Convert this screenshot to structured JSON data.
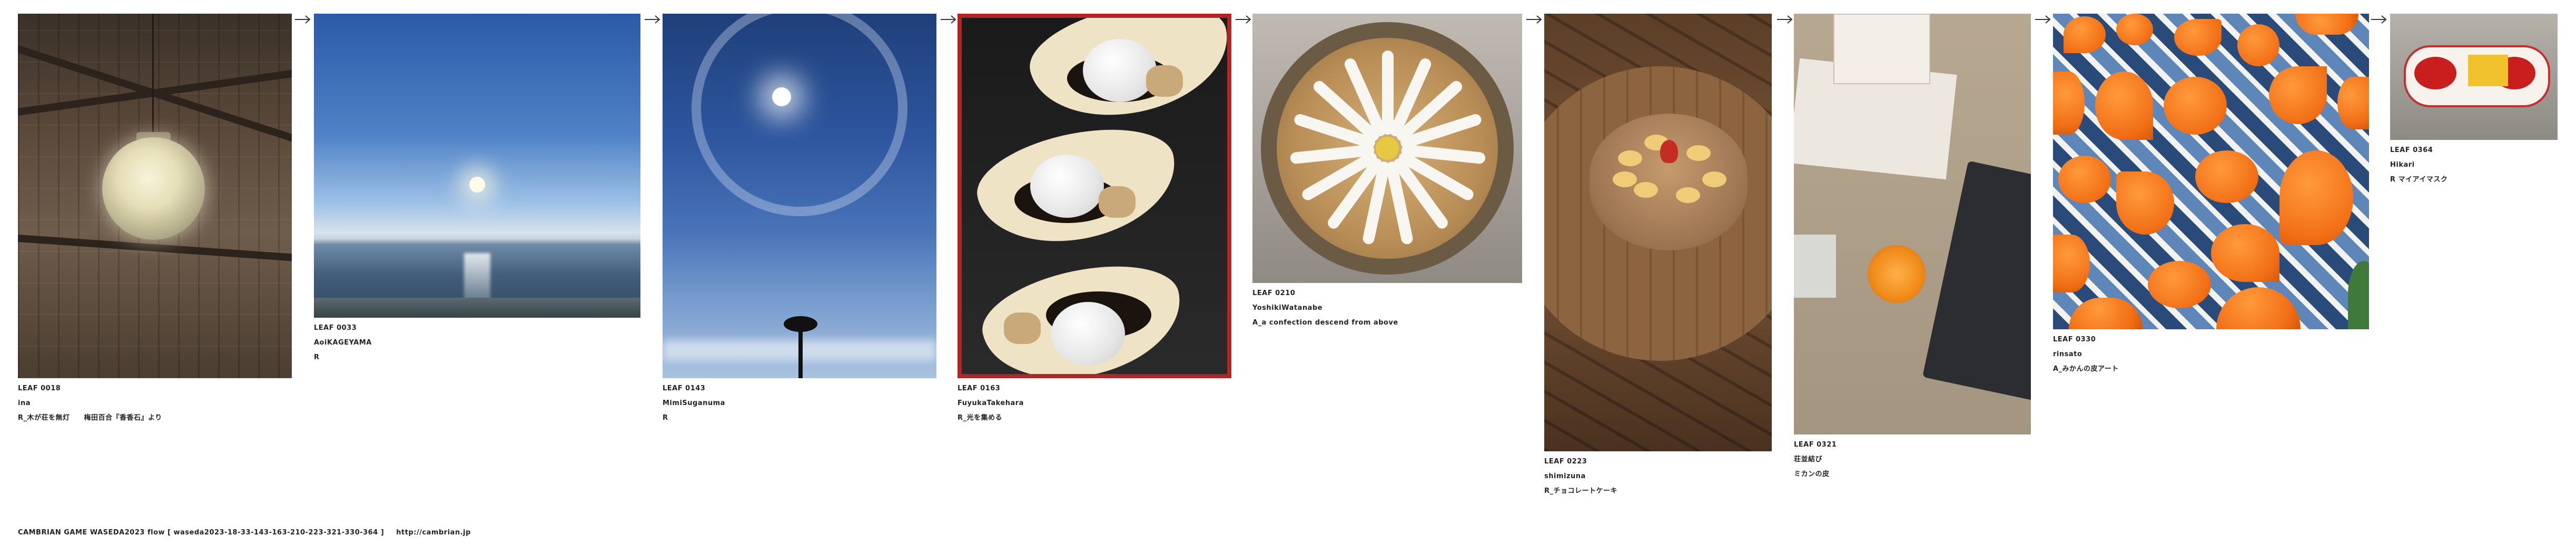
{
  "leaves": [
    {
      "id": "LEAF 0018",
      "author": "ina",
      "title": "R_木が荘を無灯　　梅田百合『香香石』より"
    },
    {
      "id": "LEAF 0033",
      "author": "AoiKAGEYAMA",
      "title": "R"
    },
    {
      "id": "LEAF 0143",
      "author": "MimiSuganuma",
      "title": "R"
    },
    {
      "id": "LEAF 0163",
      "author": "FuyukaTakehara",
      "title": "R_光を集める"
    },
    {
      "id": "LEAF 0210",
      "author": "YoshikiWatanabe",
      "title": "A_a confection descend from above"
    },
    {
      "id": "LEAF 0223",
      "author": "shimizuna",
      "title": "R_チョコレートケーキ"
    },
    {
      "id": "LEAF 0321",
      "author": "荘並結び",
      "title": "ミカンの皮"
    },
    {
      "id": "LEAF 0330",
      "author": "rinsato",
      "title": "A_みかんの皮アート"
    },
    {
      "id": "LEAF 0364",
      "author": "Hikari",
      "title": "R マイアイマスク"
    }
  ],
  "footer": {
    "left": "CAMBRIAN GAME  WASEDA2023  flow [ waseda2023-18-33-143-163-210-223-321-330-364 ]",
    "url": "http://cambrian.jp"
  }
}
